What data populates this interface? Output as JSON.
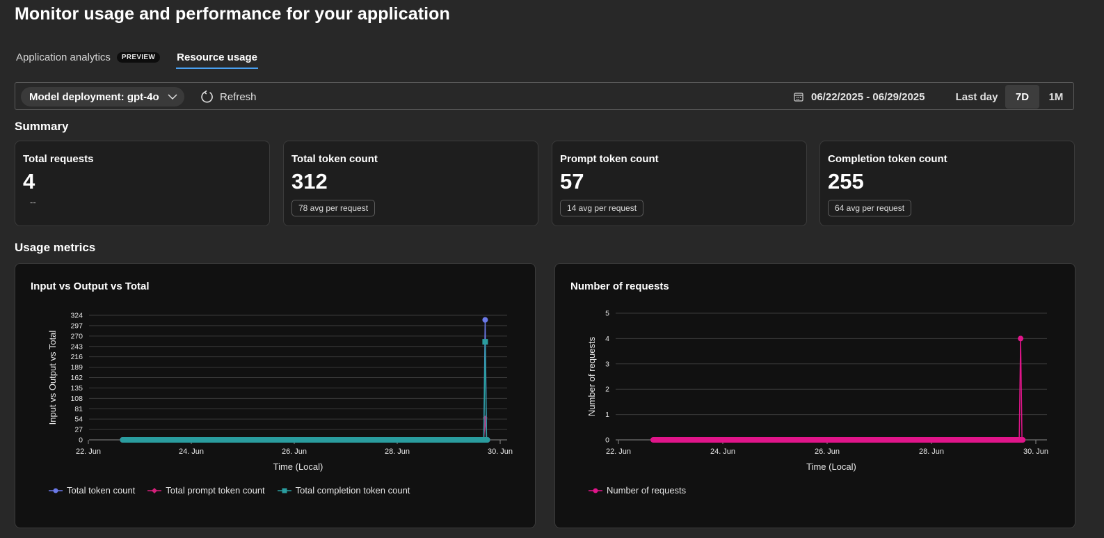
{
  "page": {
    "title": "Monitor usage and performance for your application"
  },
  "tabs": [
    {
      "label": "Application analytics",
      "badge": "PREVIEW",
      "active": false
    },
    {
      "label": "Resource usage",
      "active": true
    }
  ],
  "toolbar": {
    "deployment_label": "Model deployment: gpt-4o",
    "refresh_label": "Refresh",
    "date_range": "06/22/2025 - 06/29/2025",
    "ranges": [
      {
        "label": "Last day",
        "selected": false
      },
      {
        "label": "7D",
        "selected": true
      },
      {
        "label": "1M",
        "selected": false
      }
    ]
  },
  "summary": {
    "title": "Summary",
    "cards": [
      {
        "label": "Total requests",
        "value": "4",
        "sub": "--"
      },
      {
        "label": "Total token count",
        "value": "312",
        "sub": "78 avg per request"
      },
      {
        "label": "Prompt token count",
        "value": "57",
        "sub": "14 avg per request"
      },
      {
        "label": "Completion token count",
        "value": "255",
        "sub": "64 avg per request"
      }
    ]
  },
  "usage": {
    "title": "Usage metrics"
  },
  "colors": {
    "total": "#6b79e8",
    "prompt": "#d4207a",
    "completion": "#2a9d9f",
    "requests": "#e0158a"
  },
  "chart_data": [
    {
      "type": "line",
      "title": "Input vs Output vs Total",
      "xlabel": "Time (Local)",
      "ylabel": "Input vs Output vs Total",
      "x_ticks": [
        "22. Jun",
        "24. Jun",
        "26. Jun",
        "28. Jun",
        "30. Jun"
      ],
      "y_ticks": [
        0,
        27,
        54,
        81,
        108,
        135,
        162,
        189,
        216,
        243,
        270,
        297,
        324
      ],
      "ylim": [
        0,
        324
      ],
      "x_range": [
        "2025-06-22",
        "2025-06-30"
      ],
      "zero_range": [
        "2025-06-22T16:00",
        "2025-06-29T18:00"
      ],
      "spike_x": "2025-06-29T17:00",
      "series": [
        {
          "name": "Total token count",
          "spike_value": 312,
          "marker": "circle"
        },
        {
          "name": "Total prompt token count",
          "spike_value": 57,
          "marker": "diamond"
        },
        {
          "name": "Total completion token count",
          "spike_value": 255,
          "marker": "square"
        }
      ],
      "legend_position": "bottom-left",
      "grid": true
    },
    {
      "type": "line",
      "title": "Number of requests",
      "xlabel": "Time (Local)",
      "ylabel": "Number of requests",
      "x_ticks": [
        "22. Jun",
        "24. Jun",
        "26. Jun",
        "28. Jun",
        "30. Jun"
      ],
      "y_ticks": [
        0,
        1,
        2,
        3,
        4,
        5
      ],
      "ylim": [
        0,
        5
      ],
      "x_range": [
        "2025-06-22",
        "2025-06-30"
      ],
      "zero_range": [
        "2025-06-22T16:00",
        "2025-06-29T18:00"
      ],
      "spike_x": "2025-06-29T17:00",
      "series": [
        {
          "name": "Number of requests",
          "spike_value": 4,
          "marker": "circle"
        }
      ],
      "legend_position": "bottom-left",
      "grid": true
    }
  ]
}
